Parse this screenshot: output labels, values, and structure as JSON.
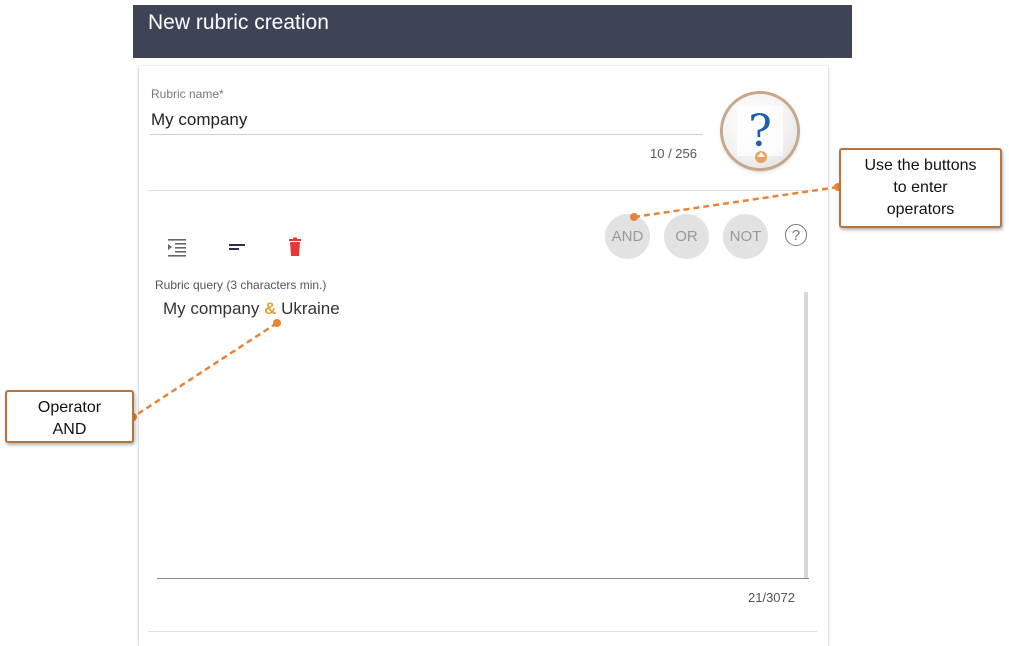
{
  "header": {
    "title": "New rubric creation"
  },
  "rubric_name": {
    "label": "Rubric name",
    "required_mark": "*",
    "value": "My company",
    "counter": "10 / 256"
  },
  "toolbar": {
    "icons": [
      "indent-icon",
      "align-icon",
      "trash-icon"
    ],
    "operators": {
      "and": "AND",
      "or": "OR",
      "not": "NOT"
    },
    "help_symbol": "?"
  },
  "query": {
    "label": "Rubric query (3 characters min.)",
    "part1": "My company",
    "operator": "&",
    "part2": "Ukraine",
    "counter": "21/3072"
  },
  "callouts": {
    "buttons": {
      "line1": "Use the buttons",
      "line2": "to enter",
      "line3": "operators"
    },
    "operator": {
      "line1": "Operator",
      "line2": "AND"
    }
  },
  "colors": {
    "header_bg": "#3e4358",
    "operator_accent": "#e8a13a",
    "callout_border": "#b8733f",
    "delete_red": "#e53935"
  }
}
